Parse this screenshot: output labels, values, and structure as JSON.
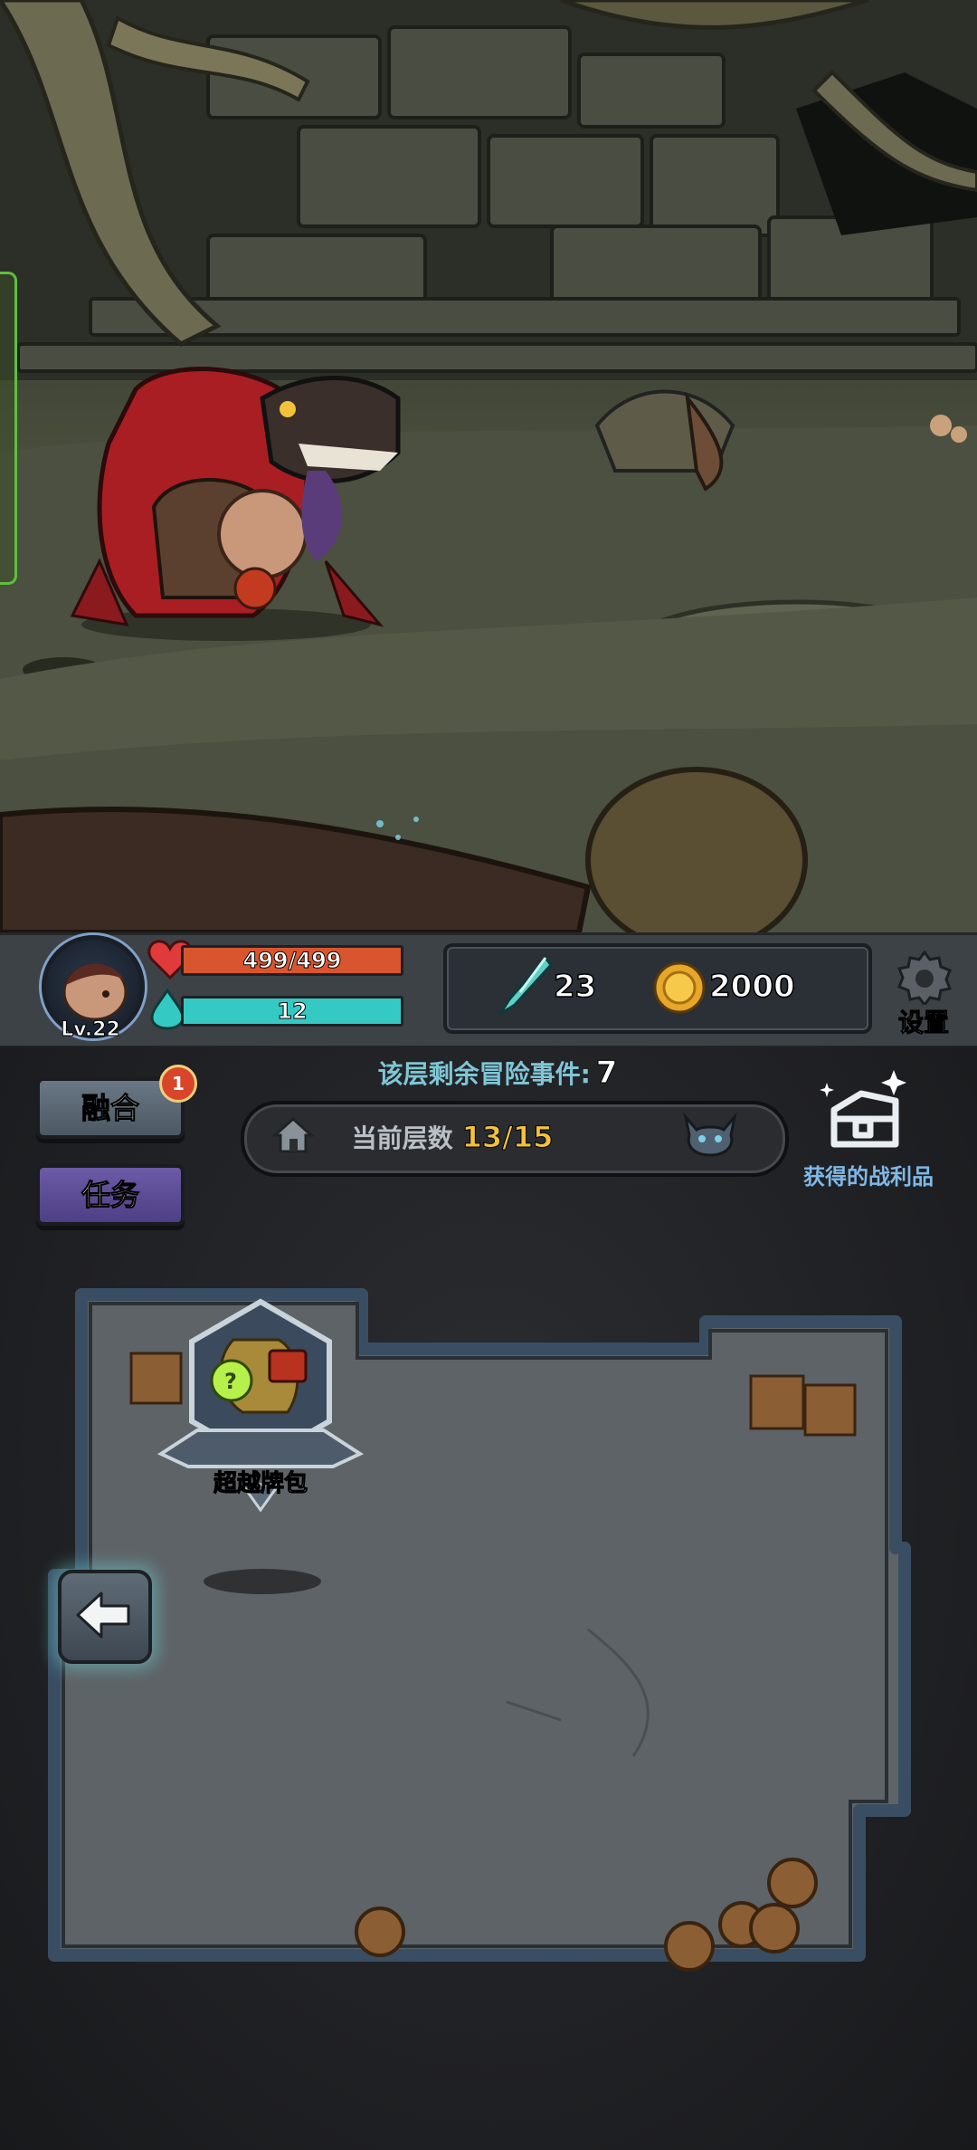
{
  "hud": {
    "level": "Lv.22",
    "hp": "499/499",
    "hp_fraction": 1.0,
    "mana": "12",
    "mana_fraction": 1.0,
    "crystals": "23",
    "gold": "2000",
    "settings_label": "设置"
  },
  "panel": {
    "fuse_label": "融合",
    "fuse_badge": "1",
    "task_label": "任务",
    "remain_label": "该层剩余冒险事件:",
    "remain_value": "7",
    "floor_label": "当前层数",
    "floor_value": "13/15",
    "loot_label": "获得的战利品"
  },
  "room": {
    "pack_label": "超越牌包"
  },
  "colors": {
    "hp": "#d9552e",
    "mana": "#35c9c3",
    "floor_value": "#f3c23b",
    "task_button": "#5c4a98",
    "fuse_button": "#5a6774"
  },
  "icons": [
    "heart-icon",
    "mana-drop-icon",
    "crystal-icon",
    "gold-coin-icon",
    "gear-icon",
    "house-icon",
    "demon-head-icon",
    "treasure-chest-icon",
    "back-arrow-icon"
  ]
}
